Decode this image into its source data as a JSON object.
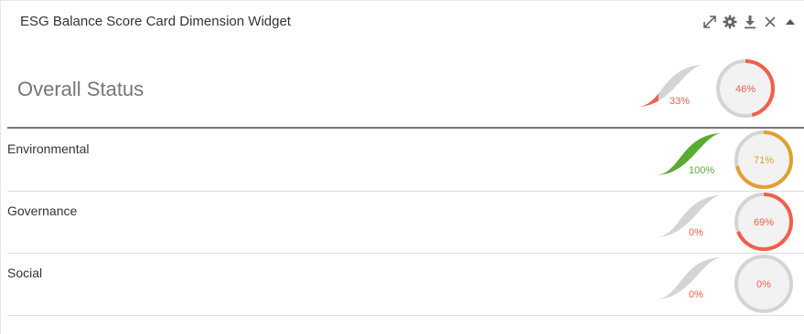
{
  "widget": {
    "title": "ESG Balance Score Card Dimension Widget",
    "toolbar_icons": [
      "expand-icon",
      "gear-icon",
      "download-icon",
      "close-icon",
      "collapse-caret-icon"
    ]
  },
  "overall": {
    "label": "Overall Status",
    "trend_value": 33,
    "trend_label": "33%",
    "trend_color": "#f0604a",
    "score_value": 46,
    "score_label": "46%",
    "score_color": "#f0604a"
  },
  "rows": [
    {
      "label": "Environmental",
      "trend_value": 100,
      "trend_label": "100%",
      "trend_color": "#5aaa33",
      "score_value": 71,
      "score_label": "71%",
      "score_color": "#e0a030"
    },
    {
      "label": "Governance",
      "trend_value": 0,
      "trend_label": "0%",
      "trend_color": "#f0604a",
      "score_value": 69,
      "score_label": "69%",
      "score_color": "#f0604a"
    },
    {
      "label": "Social",
      "trend_value": 0,
      "trend_label": "0%",
      "trend_color": "#f0604a",
      "score_value": 0,
      "score_label": "0%",
      "score_color": "#f0604a"
    }
  ],
  "colors": {
    "track": "#d4d4d4",
    "ring_fill": "#f2f2f2"
  }
}
